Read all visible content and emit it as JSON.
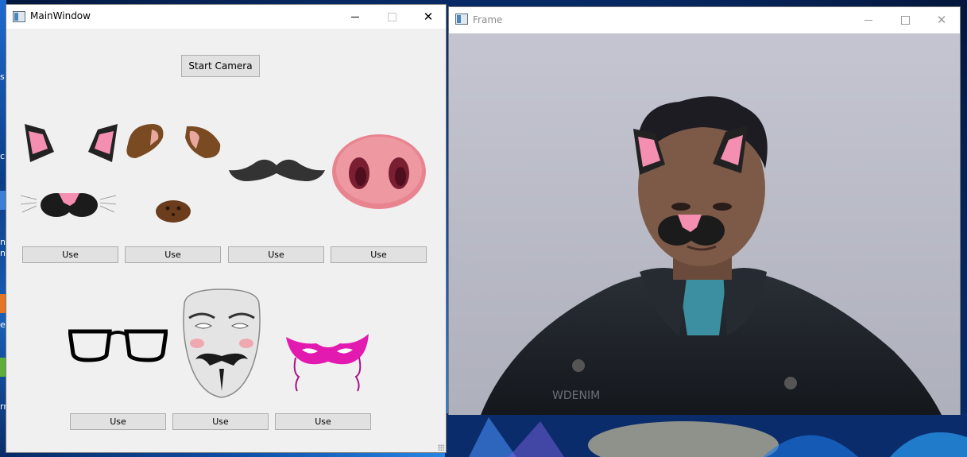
{
  "main_window": {
    "title": "MainWindow",
    "start_button": "Start Camera",
    "use_label": "Use",
    "filters_row1": [
      "cat-ears-nose-icon",
      "dog-ears-nose-icon",
      "mustache-icon",
      "pig-nose-icon"
    ],
    "filters_row2": [
      "glasses-icon",
      "anonymous-mask-icon",
      "masquerade-mask-icon"
    ]
  },
  "frame_window": {
    "title": "Frame",
    "preview": "webcam-preview-with-cat-filter"
  },
  "desktop": {
    "snippets": [
      "s",
      "cl",
      "nt",
      "n",
      "ea",
      "rr"
    ]
  },
  "colors": {
    "window_bg": "#f0f0f0",
    "button_bg": "#e1e1e1",
    "button_border": "#adadad",
    "desktop_blue": "#0d4fa8",
    "cat_pink": "#f48fb1",
    "pig_pink": "#e8848f",
    "mask_magenta": "#e21ab0"
  }
}
